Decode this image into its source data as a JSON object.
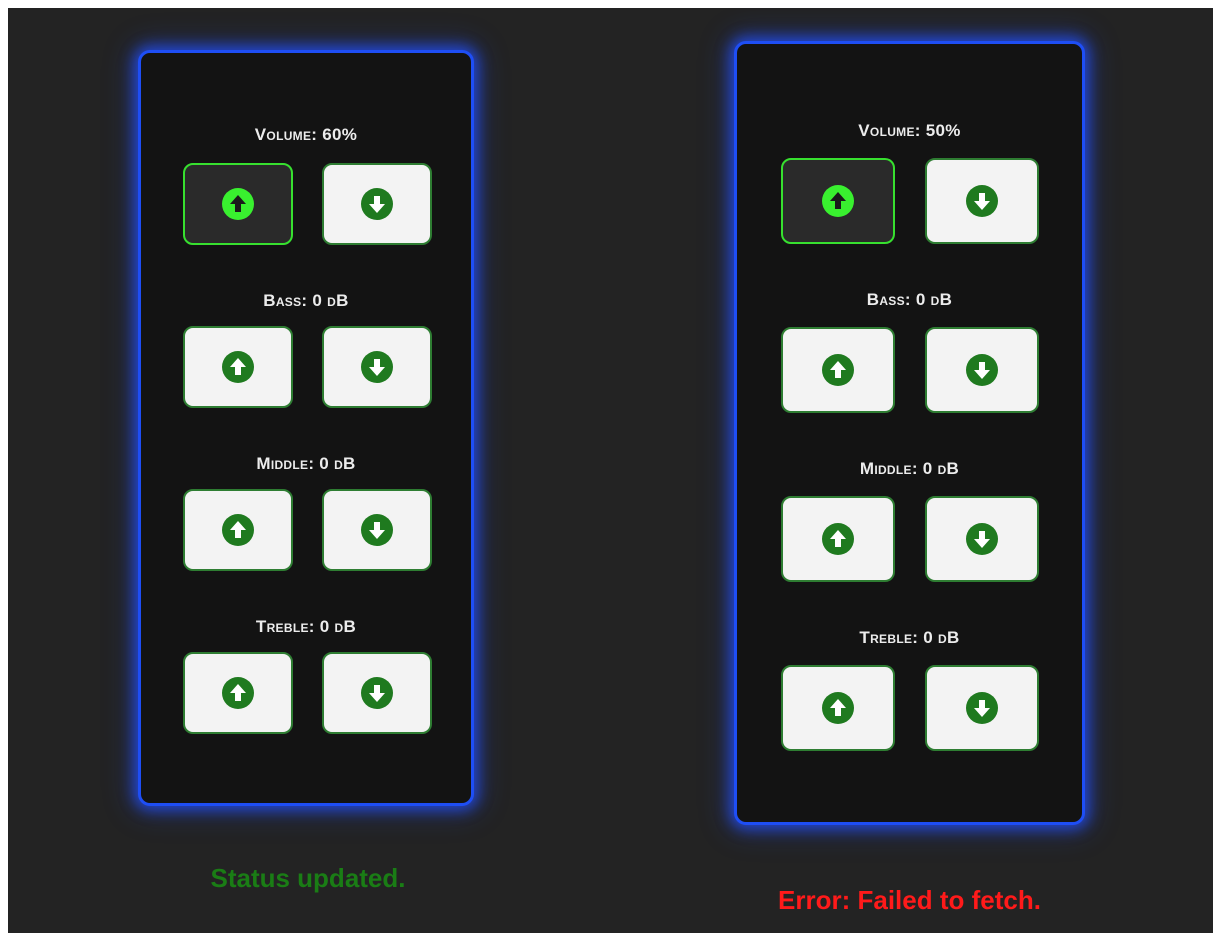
{
  "colors": {
    "page_bg": "#232323",
    "panel_bg": "#131313",
    "panel_border": "#1e4ef5",
    "button_bg": "#f3f3f3",
    "button_border": "#2e7d32",
    "active_border": "#37e02f",
    "icon_green": "#1f7a1f",
    "active_icon": "#39f02f",
    "status_ok": "#1a7d15",
    "status_error": "#ff1a1a"
  },
  "icons": {
    "up": "arrow-circle-up-icon",
    "down": "arrow-circle-down-icon"
  },
  "panels": [
    {
      "volume": {
        "label": "Volume: 60%",
        "up_active": true
      },
      "bass": {
        "label": "Bass: 0 dB"
      },
      "middle": {
        "label": "Middle: 0 dB"
      },
      "treble": {
        "label": "Treble: 0 dB"
      },
      "status": "Status updated."
    },
    {
      "volume": {
        "label": "Volume: 50%",
        "up_active": true
      },
      "bass": {
        "label": "Bass: 0 dB"
      },
      "middle": {
        "label": "Middle: 0 dB"
      },
      "treble": {
        "label": "Treble: 0 dB"
      },
      "status": "Error: Failed to fetch."
    }
  ]
}
